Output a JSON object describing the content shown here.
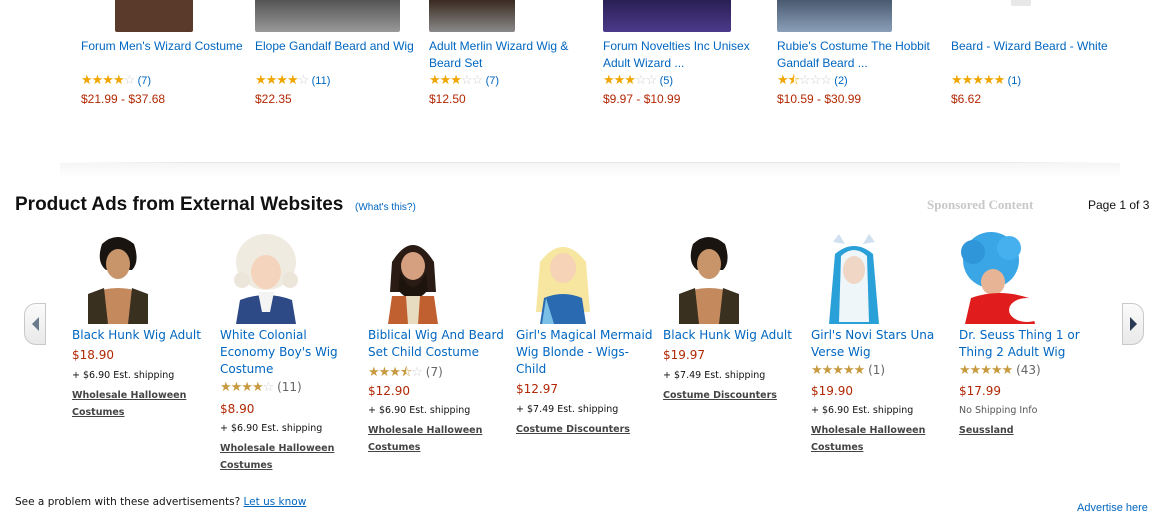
{
  "top_products": [
    {
      "title": "Forum Men's Wizard Costume",
      "stars": 4,
      "count": "(7)",
      "price": "$21.99 - $37.68",
      "img_color": "#5a3a2a"
    },
    {
      "title": "Elope Gandalf Beard and Wig",
      "stars": 4,
      "count": "(11)",
      "price": "$22.35",
      "img_color": "#7a7a7a"
    },
    {
      "title": "Adult Merlin Wizard Wig & Beard Set",
      "stars": 3,
      "count": "(7)",
      "price": "$12.50",
      "img_color": "#4a3a30"
    },
    {
      "title": "Forum Novelties Inc Unisex Adult Wizard ...",
      "stars": 3,
      "count": "(5)",
      "price": "$9.97 - $10.99",
      "img_color": "#3a2a6a"
    },
    {
      "title": "Rubie's Costume The Hobbit Gandalf Beard ...",
      "stars": 1.5,
      "count": "(2)",
      "price": "$10.59 - $30.99",
      "img_color": "#6a7a90"
    },
    {
      "title": "Beard - Wizard Beard - White",
      "stars": 5,
      "count": "(1)",
      "price": "$6.62",
      "img_color": "#eeeeee"
    }
  ],
  "section": {
    "title": "Product Ads from External Websites",
    "whats_this": "(What's this?)",
    "sponsored": "Sponsored Content",
    "page_info": "Page 1 of 3"
  },
  "ads": [
    {
      "title": "Black Hunk Wig Adult",
      "price": "$18.90",
      "shipping": "+ $6.90 Est. shipping",
      "seller": "Wholesale Halloween Costumes"
    },
    {
      "title": "White Colonial Economy Boy's Wig Costume",
      "stars": 4,
      "count": "(11)",
      "price": "$8.90",
      "shipping": "+ $6.90 Est. shipping",
      "seller": "Wholesale Halloween Costumes"
    },
    {
      "title": "Biblical Wig And Beard Set Child Costume",
      "stars": 3.5,
      "count": "(7)",
      "price": "$12.90",
      "shipping": "+ $6.90 Est. shipping",
      "seller": "Wholesale Halloween Costumes"
    },
    {
      "title": "Girl's Magical Mermaid Wig Blonde - Wigs-Child",
      "price": "$12.97",
      "shipping": "+ $7.49 Est. shipping",
      "seller": "Costume Discounters"
    },
    {
      "title": "Black Hunk Wig Adult",
      "price": "$19.97",
      "shipping": "+ $7.49 Est. shipping",
      "seller": "Costume Discounters"
    },
    {
      "title": "Girl's Novi Stars Una Verse Wig",
      "stars": 5,
      "count": "(1)",
      "price": "$19.90",
      "shipping": "+ $6.90 Est. shipping",
      "seller": "Wholesale Halloween Costumes"
    },
    {
      "title": "Dr. Seuss Thing 1 or Thing 2 Adult Wig",
      "stars": 5,
      "count": "(43)",
      "price": "$17.99",
      "shipping": "No Shipping Info",
      "seller": "Seussland"
    }
  ],
  "footer": {
    "question": "See a problem with these advertisements?",
    "let_us_know": "Let us know",
    "advertise": "Advertise here"
  },
  "icons": {
    "prev": "chevron-left-icon",
    "next": "chevron-right-icon"
  },
  "colors": {
    "link": "#0066c0",
    "price": "#b12704",
    "star": "#f0a500"
  }
}
